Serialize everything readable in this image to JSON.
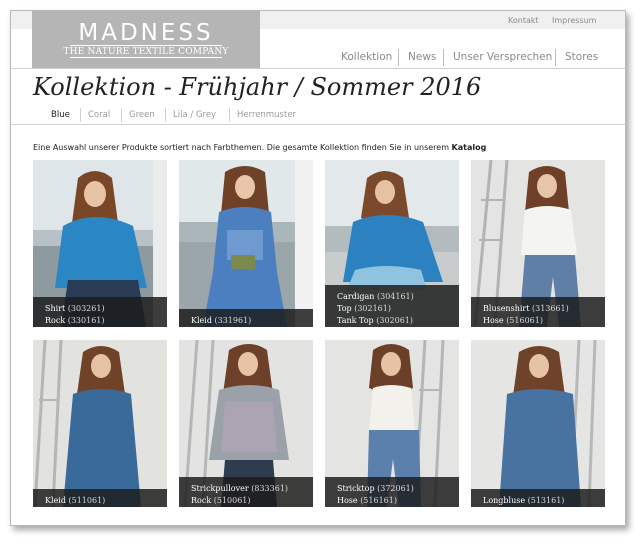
{
  "brand": {
    "name": "MADNESS",
    "tagline": "THE NATURE TEXTILE COMPANY"
  },
  "utility_nav": [
    "Kontakt",
    "Impressum"
  ],
  "main_nav": [
    "Kollektion",
    "News",
    "Unser Versprechen",
    "Stores"
  ],
  "page_title": "Kollektion - Frühjahr / Sommer 2016",
  "color_tabs": [
    "Blue",
    "Coral",
    "Green",
    "Lila / Grey",
    "Herrenmuster"
  ],
  "active_tab": "Blue",
  "intro": {
    "text": "Eine Auswahl unserer Produkte sortiert nach Farbthemen. Die gesamte Kollektion finden Sie in unserem ",
    "link": "Katalog"
  },
  "products": [
    {
      "lines": [
        {
          "name": "Shirt",
          "code": "(303261)"
        },
        {
          "name": "Rock",
          "code": "(330161)"
        }
      ]
    },
    {
      "lines": [
        {
          "name": "Kleid",
          "code": "(331961)"
        }
      ]
    },
    {
      "lines": [
        {
          "name": "Cardigan",
          "code": "(304161)"
        },
        {
          "name": "Top",
          "code": "(302161)"
        },
        {
          "name": "Tank Top",
          "code": "(302061)"
        }
      ]
    },
    {
      "lines": [
        {
          "name": "Blusenshirt",
          "code": "(313661)"
        },
        {
          "name": "Hose",
          "code": "(516061)"
        }
      ]
    },
    {
      "lines": [
        {
          "name": "Kleid",
          "code": "(511061)"
        }
      ]
    },
    {
      "lines": [
        {
          "name": "Strickpullover",
          "code": "(833361)"
        },
        {
          "name": "Rock",
          "code": "(510061)"
        }
      ]
    },
    {
      "lines": [
        {
          "name": "Stricktop",
          "code": "(372061)"
        },
        {
          "name": "Hose",
          "code": "(516161)"
        }
      ]
    },
    {
      "lines": [
        {
          "name": "Longbluse",
          "code": "(513161)"
        }
      ]
    }
  ]
}
